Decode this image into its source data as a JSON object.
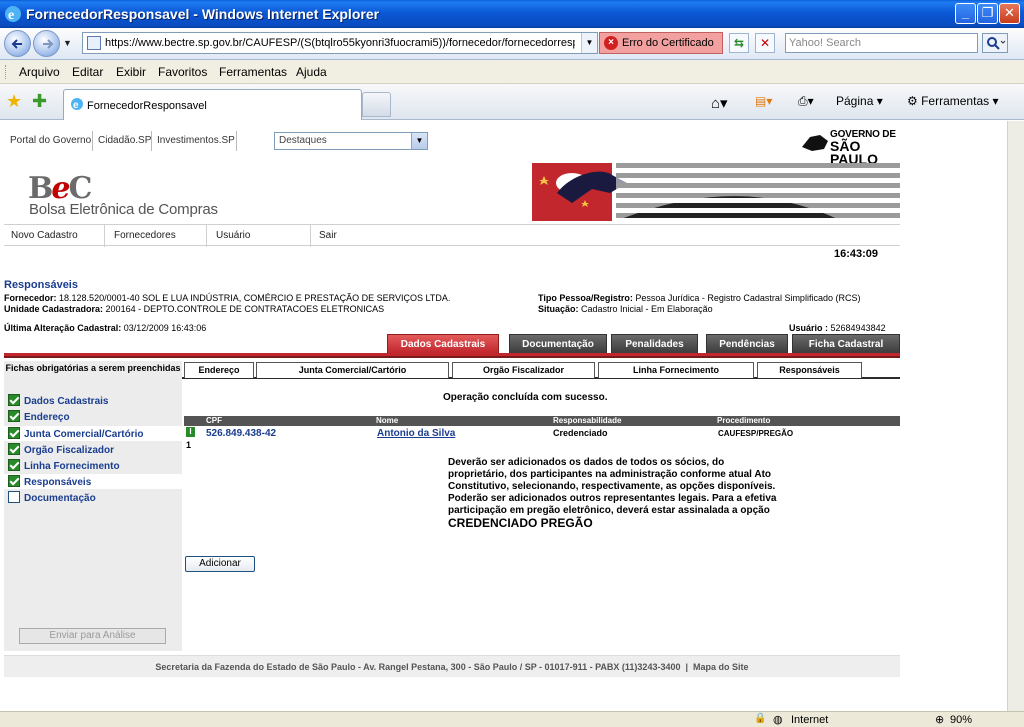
{
  "window": {
    "title": "FornecedorResponsavel - Windows Internet Explorer"
  },
  "address": {
    "url": "https://www.bectre.sp.gov.br/CAUFESP/(S(btqlro55kyonri3fuocrami5))/fornecedor/fornecedorresp",
    "cert_error": "Erro do Certificado",
    "search_placeholder": "Yahoo! Search"
  },
  "menu": [
    "Arquivo",
    "Editar",
    "Exibir",
    "Favoritos",
    "Ferramentas",
    "Ajuda"
  ],
  "tabs": {
    "active": "FornecedorResponsavel"
  },
  "commands": {
    "page": "Página",
    "tools": "Ferramentas"
  },
  "gov": {
    "links": [
      "Portal do Governo",
      "Cidadão.SP",
      "Investimentos.SP"
    ],
    "destaques": "Destaques",
    "logo_line1": "GOVERNO DE",
    "logo_line2": "SÃO PAULO"
  },
  "bec": {
    "name": "Bolsa Eletrônica de Compras"
  },
  "mainnav": [
    "Novo Cadastro",
    "Fornecedores",
    "Usuário",
    "Sair"
  ],
  "clock": "16:43:09",
  "header": {
    "title": "Responsáveis",
    "fornecedor_label": "Fornecedor:",
    "fornecedor_value": "18.128.520/0001-40 SOL E LUA INDÚSTRIA, COMÉRCIO E PRESTAÇÃO DE SERVIÇOS LTDA.",
    "unidade_label": "Unidade Cadastradora:",
    "unidade_value": "200164 - DEPTO.CONTROLE DE CONTRATACOES ELETRONICAS",
    "tipo_label": "Tipo Pessoa/Registro:",
    "tipo_value": "Pessoa Jurídica - Registro Cadastral Simplificado (RCS)",
    "situacao_label": "Situação:",
    "situacao_value": "Cadastro Inicial - Em Elaboração",
    "ultima_label": "Última Alteração Cadastral:",
    "ultima_value": "03/12/2009 16:43:06",
    "usuario_label": "Usuário :",
    "usuario_value": "52684943842"
  },
  "page_tabs": [
    "Dados Cadastrais",
    "Documentação",
    "Penalidades",
    "Pendências",
    "Ficha Cadastral"
  ],
  "sidebar": {
    "header": "Fichas obrigatórias a serem preenchidas",
    "items": [
      {
        "label": "Dados Cadastrais",
        "checked": true
      },
      {
        "label": "Endereço",
        "checked": true
      },
      {
        "label": "Junta Comercial/Cartório",
        "checked": true
      },
      {
        "label": "Orgão Fiscalizador",
        "checked": true
      },
      {
        "label": "Linha Fornecimento",
        "checked": true
      },
      {
        "label": "Responsáveis",
        "checked": true
      },
      {
        "label": "Documentação",
        "checked": false
      }
    ],
    "submit": "Enviar para Análise"
  },
  "subtabs": [
    "Endereço",
    "Junta Comercial/Cartório",
    "Orgão Fiscalizador",
    "Linha Fornecimento",
    "Responsáveis"
  ],
  "content": {
    "success": "Operação concluída com sucesso.",
    "columns": [
      "CPF",
      "Nome",
      "Responsabilidade",
      "Procedimento"
    ],
    "rows": [
      {
        "cpf": "526.849.438-42",
        "nome": "Antonio da Silva",
        "resp": "Credenciado",
        "proc": "CAUFESP/PREGÃO",
        "index": "1"
      }
    ],
    "note": "Deverão ser adicionados os dados de todos os sócios, do proprietário, dos participantes na administração conforme atual Ato Constitutivo, selecionando, respectivamente, as opções disponíveis. Poderão ser adicionados outros representantes legais. Para a efetiva participação em pregão eletrônico, deverá estar assinalada a opção",
    "note_big": "CREDENCIADO PREGÃO",
    "add_button": "Adicionar"
  },
  "footer": {
    "text": "Secretaria da Fazenda do Estado de São Paulo - Av. Rangel Pestana, 300 - São Paulo / SP - 01017-911 - PABX (11)3243-3400",
    "sep": "|",
    "mapa": "Mapa do Site"
  },
  "status": {
    "zone": "Internet",
    "zoom": "90%"
  },
  "colors": {
    "accent_red": "#c1272d",
    "link_blue": "#1a3d8f",
    "titlebar_blue": "#0a4bc0"
  }
}
